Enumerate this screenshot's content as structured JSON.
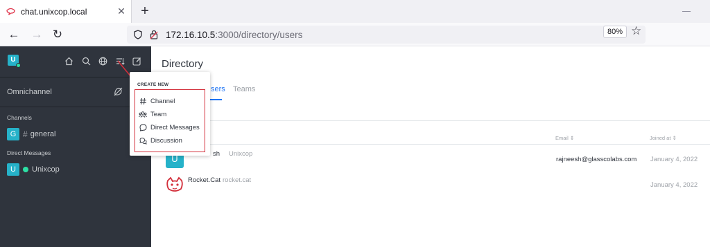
{
  "browser": {
    "tab_title": "chat.unixcop.local",
    "url_host": "172.16.10.5",
    "url_path": ":3000/directory/users",
    "zoom": "80%"
  },
  "sidebar": {
    "avatar_letter": "U",
    "omnichannel_label": "Omnichannel",
    "channels_header": "Channels",
    "channels": [
      {
        "avatar": "G",
        "name": "general"
      }
    ],
    "dm_header": "Direct Messages",
    "dms": [
      {
        "avatar": "U",
        "name": "Unixcop"
      }
    ]
  },
  "create_menu": {
    "title": "CREATE NEW",
    "items": [
      {
        "label": "Channel",
        "icon": "hash-icon"
      },
      {
        "label": "Team",
        "icon": "team-icon"
      },
      {
        "label": "Direct Messages",
        "icon": "chat-bubble-icon"
      },
      {
        "label": "Discussion",
        "icon": "discussion-icon"
      }
    ]
  },
  "directory": {
    "title": "Directory",
    "tabs": [
      "sers",
      "Teams"
    ],
    "columns": {
      "email": "Email",
      "joined": "Joined at"
    },
    "rows": [
      {
        "avatar": "U",
        "name": "sh",
        "username": "Unixcop",
        "email": "rajneesh@glasscolabs.com",
        "joined": "January 4, 2022"
      },
      {
        "avatar": "cat",
        "name": "Rocket.Cat",
        "username": "rocket.cat",
        "email": "",
        "joined": "January 4, 2022"
      }
    ]
  },
  "colors": {
    "sidebar_bg": "#2f343d",
    "accent": "#1d74f5",
    "avatar_teal": "#26b2c9",
    "highlight_red": "#d32f3b"
  }
}
